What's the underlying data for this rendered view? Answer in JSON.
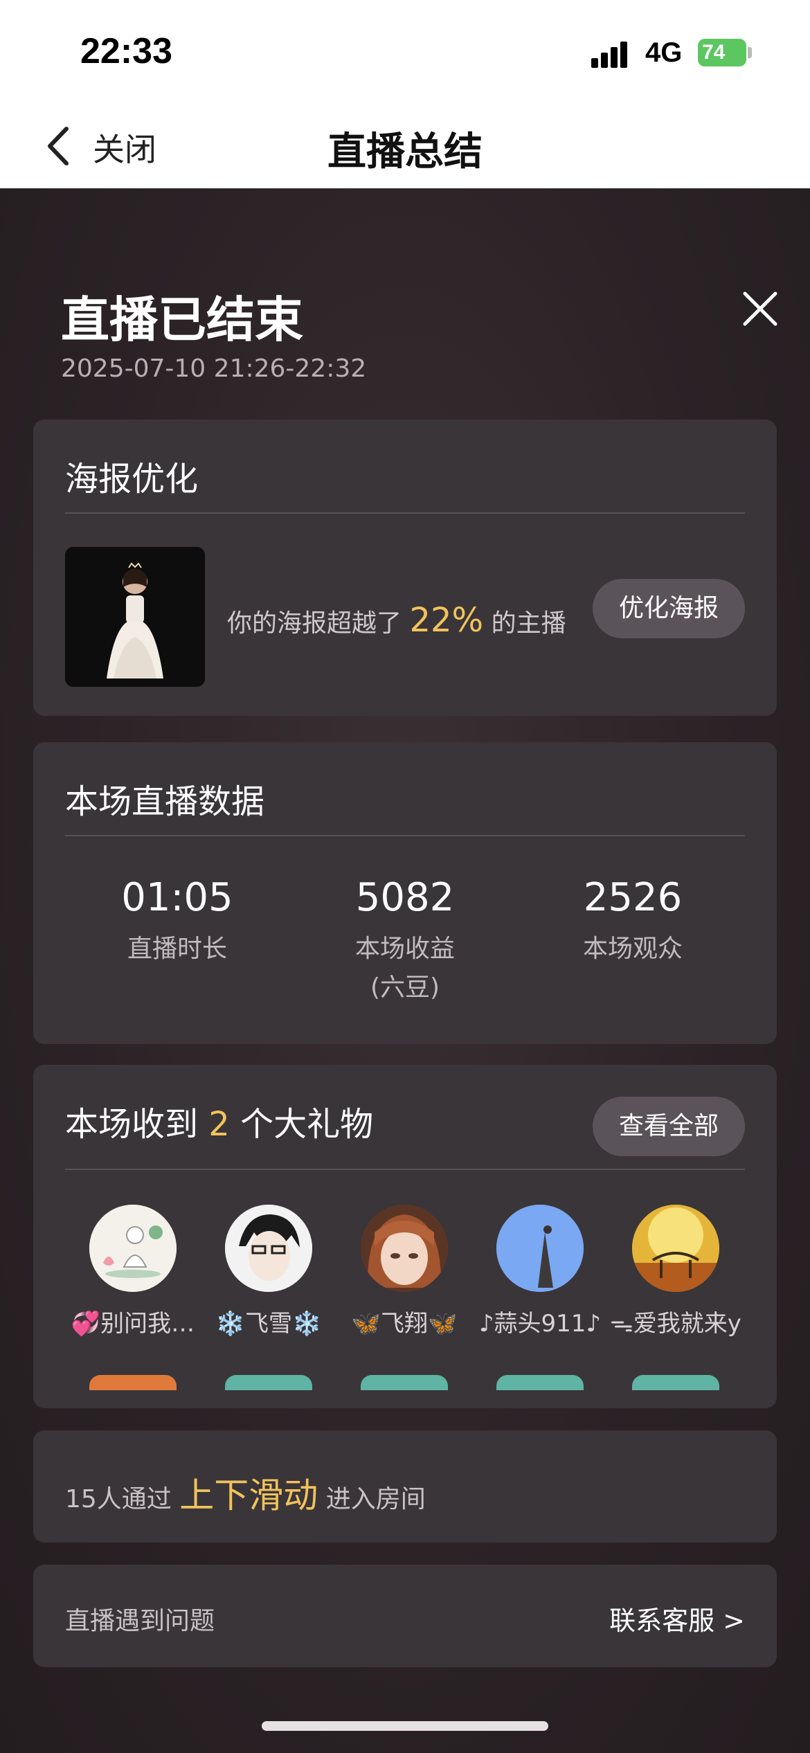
{
  "status_bar": {
    "time": "22:33",
    "network": "4G",
    "battery": "74"
  },
  "nav": {
    "back_label": "关闭",
    "title": "直播总结"
  },
  "summary": {
    "title": "直播已结束",
    "time_range": "2025-07-10 21:26-22:32"
  },
  "poster_card": {
    "title": "海报优化",
    "text_before": "你的海报超越了",
    "percent": "22%",
    "text_after": "的主播",
    "button": "优化海报"
  },
  "stats_card": {
    "title": "本场直播数据",
    "items": [
      {
        "value": "01:05",
        "label": "直播时长",
        "sub": ""
      },
      {
        "value": "5082",
        "label": "本场收益",
        "sub": "(六豆)"
      },
      {
        "value": "2526",
        "label": "本场观众",
        "sub": ""
      }
    ]
  },
  "gifts_card": {
    "title_before": "本场收到",
    "count": "2",
    "title_after": "个大礼物",
    "view_all": "查看全部",
    "users": [
      {
        "name": "💞别问我…"
      },
      {
        "name": "❄️飞雪❄️"
      },
      {
        "name": "🦋飞翔🦋"
      },
      {
        "name": "♪蒜头911♪"
      },
      {
        "name": "ᯓ爱我就来y"
      }
    ]
  },
  "swipe_card": {
    "before": "15人通过",
    "highlight": "上下滑动",
    "after": "进入房间"
  },
  "help_card": {
    "label": "直播遇到问题",
    "link": "联系客服 >"
  },
  "colors": {
    "accent": "#f1c35b",
    "card": "#3a3539",
    "pill": "#5b535a",
    "battery": "#5cc660"
  }
}
